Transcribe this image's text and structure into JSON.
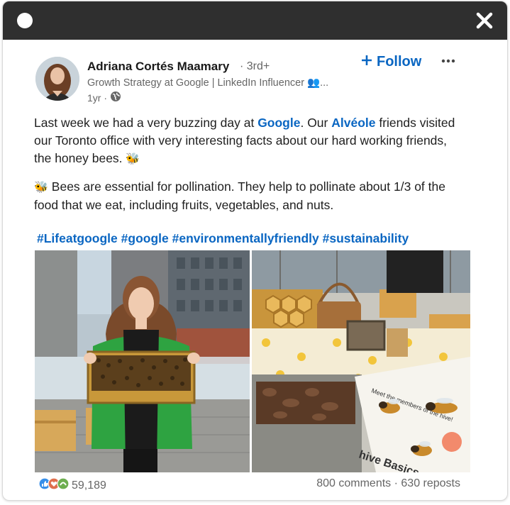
{
  "post": {
    "author": {
      "name": "Adriana Cortés Maamary",
      "degree": "· 3rd+",
      "headline": "Growth Strategy at Google | LinkedIn Influencer 👥...",
      "time": "1yr ·"
    },
    "follow_label": "Follow",
    "paragraph1": {
      "t1": "Last week we had a very buzzing day at ",
      "link1": "Google",
      "t2": ". Our ",
      "link2": "Alvéole",
      "t3": " friends visited our Toronto office with very interesting facts about our hard working friends, the honey bees. ",
      "emoji": "🐝"
    },
    "paragraph2": {
      "emoji": "🐝",
      "text": " Bees are essential for pollination. They help to pollinate about 1/3 of the food that we eat, including fruits, vegetables, and nuts."
    },
    "hashtags": [
      "#Lifeatgoogle",
      "#google",
      "#environmentallyfriendly",
      "#sustainability"
    ],
    "images": {
      "right_sign_text1": "Meet the members of the hive!",
      "right_sign_text2": "hive Basics"
    },
    "reactions_count": "59,189",
    "comments": "800 comments",
    "separator": " · ",
    "reposts": "630 reposts"
  },
  "colors": {
    "link": "#0a66c2",
    "titlebar": "#2f2f2f",
    "muted_text": "#666666"
  },
  "icons": [
    "window-dot-icon",
    "close-icon",
    "globe-icon",
    "plus-icon",
    "more-icon",
    "like-reaction-icon",
    "love-reaction-icon",
    "support-reaction-icon"
  ]
}
